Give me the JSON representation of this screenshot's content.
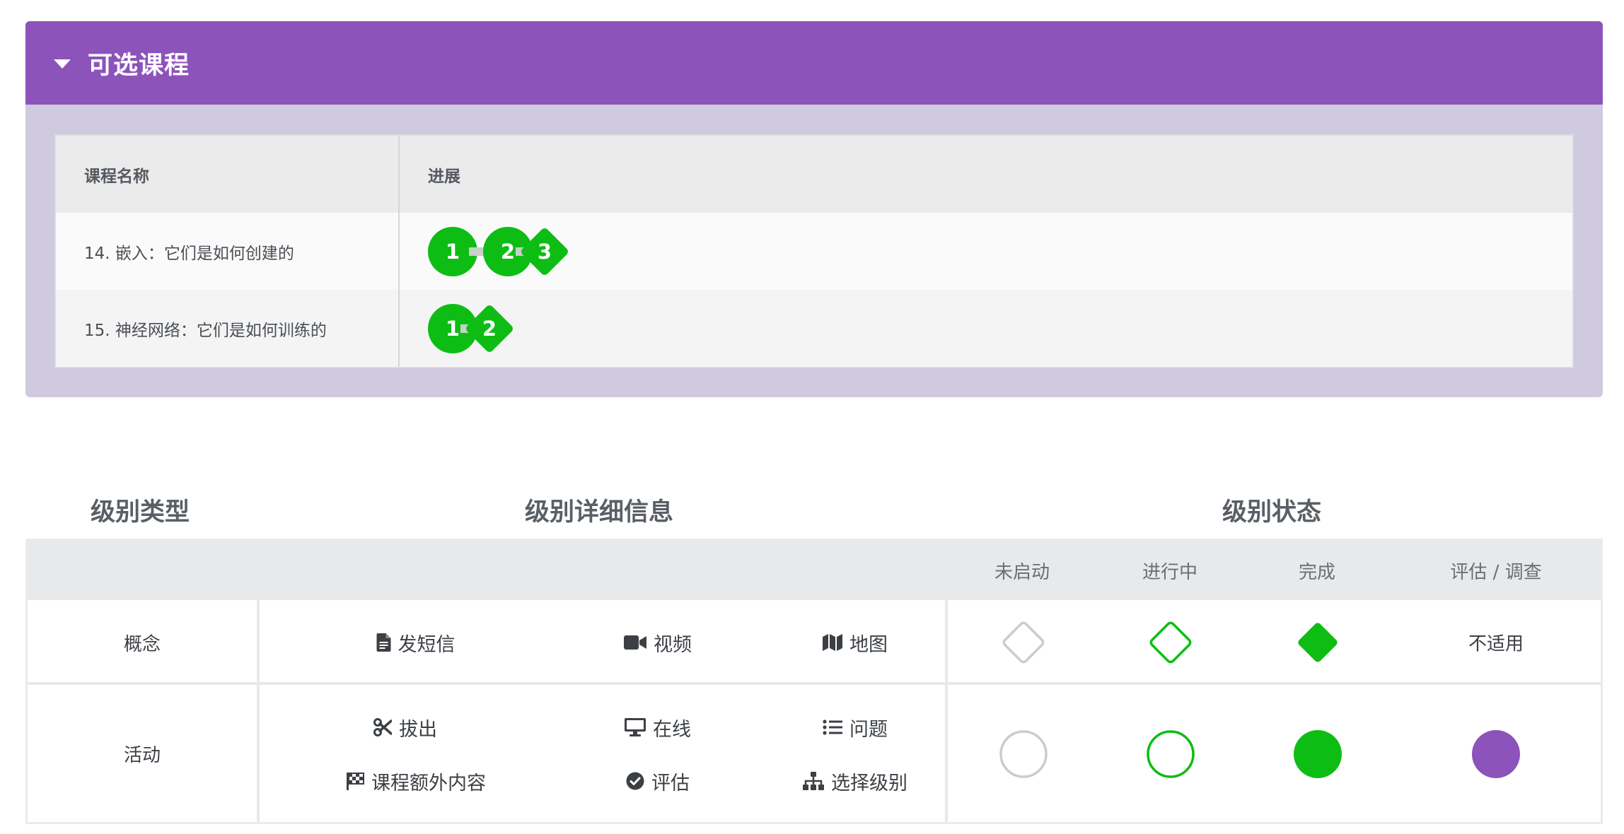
{
  "panel": {
    "title": "可选课程",
    "columns": {
      "name": "课程名称",
      "progress": "进展"
    },
    "courses": [
      {
        "name": "14. 嵌入：它们是如何创建的",
        "steps": [
          "1",
          "2",
          "3"
        ]
      },
      {
        "name": "15. 神经网络：它们是如何训练的",
        "steps": [
          "1",
          "2"
        ]
      }
    ]
  },
  "legend": {
    "headers": {
      "type": "级别类型",
      "details": "级别详细信息",
      "status": "级别状态"
    },
    "status_columns": [
      "未启动",
      "进行中",
      "完成",
      "评估 / 调查"
    ],
    "rows": {
      "concept": {
        "label": "概念",
        "details": [
          {
            "icon": "document-icon",
            "label": "发短信"
          },
          {
            "icon": "video-icon",
            "label": "视频"
          },
          {
            "icon": "map-icon",
            "label": "地图"
          }
        ],
        "na": "不适用"
      },
      "activity": {
        "label": "活动",
        "details": [
          {
            "icon": "scissors-icon",
            "label": "拔出"
          },
          {
            "icon": "monitor-icon",
            "label": "在线"
          },
          {
            "icon": "list-icon",
            "label": "问题"
          },
          {
            "icon": "flag-icon",
            "label": "课程额外内容"
          },
          {
            "icon": "check-circle-icon",
            "label": "评估"
          },
          {
            "icon": "sitemap-icon",
            "label": "选择级别"
          }
        ]
      }
    }
  },
  "colors": {
    "header_purple": "#8c53bb",
    "panel_bg": "#cfcadf",
    "complete_green": "#0dbd14",
    "not_started_gray": "#cccccc",
    "assessment_purple": "#8c53bb"
  }
}
